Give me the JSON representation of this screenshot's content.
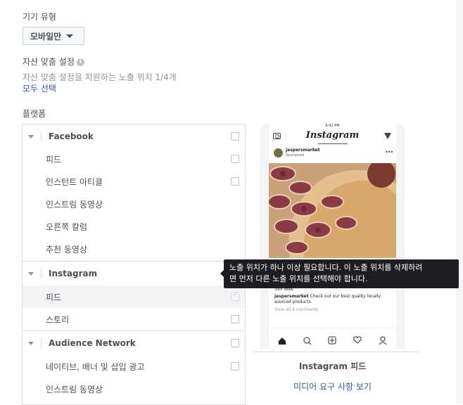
{
  "device": {
    "label": "기기 유형",
    "selected": "모바일만"
  },
  "asset": {
    "label": "자산 맞춤 설정",
    "info_icon": "i",
    "description": "자산 맞춤 설정을 지원하는 노출 위치 1/4개",
    "select_all": "모두 선택"
  },
  "platforms": {
    "label": "플랫폼",
    "facebook": {
      "name": "Facebook",
      "items": [
        "피드",
        "인스턴트 아티클",
        "인스트림 동영상",
        "오른쪽 칼럼",
        "추천 동영상"
      ]
    },
    "instagram": {
      "name": "Instagram",
      "items": [
        "피드",
        "스토리"
      ]
    },
    "audience_network": {
      "name": "Audience Network",
      "items": [
        "네이티브, 배너 및 삽입 광고",
        "인스트림 동영상"
      ]
    }
  },
  "tooltip": {
    "line1": "노출 위치가 하나 이상 필요합니다. 이 노출 위치를 삭제하려",
    "line2": "면 먼저 다른 노출 위치를 선택해야 합니다."
  },
  "preview": {
    "status_time": "9:41 PM",
    "app_name": "Instagram",
    "account": "jaspersmarket",
    "sponsored": "Sponsored",
    "likes": "345 likes",
    "caption_user": "jaspersmarket",
    "caption_text": "Check out our best quality locally",
    "caption_text2": "sourced products.",
    "comments": "View all 8 comments",
    "placement_caption": "Instagram 피드",
    "media_link": "미디어 요구 사항 보기"
  },
  "icons": [
    "camera-icon",
    "send-icon",
    "home-icon",
    "search-icon",
    "add-icon",
    "heart-icon",
    "profile-icon",
    "info-icon",
    "caret-down-icon"
  ]
}
